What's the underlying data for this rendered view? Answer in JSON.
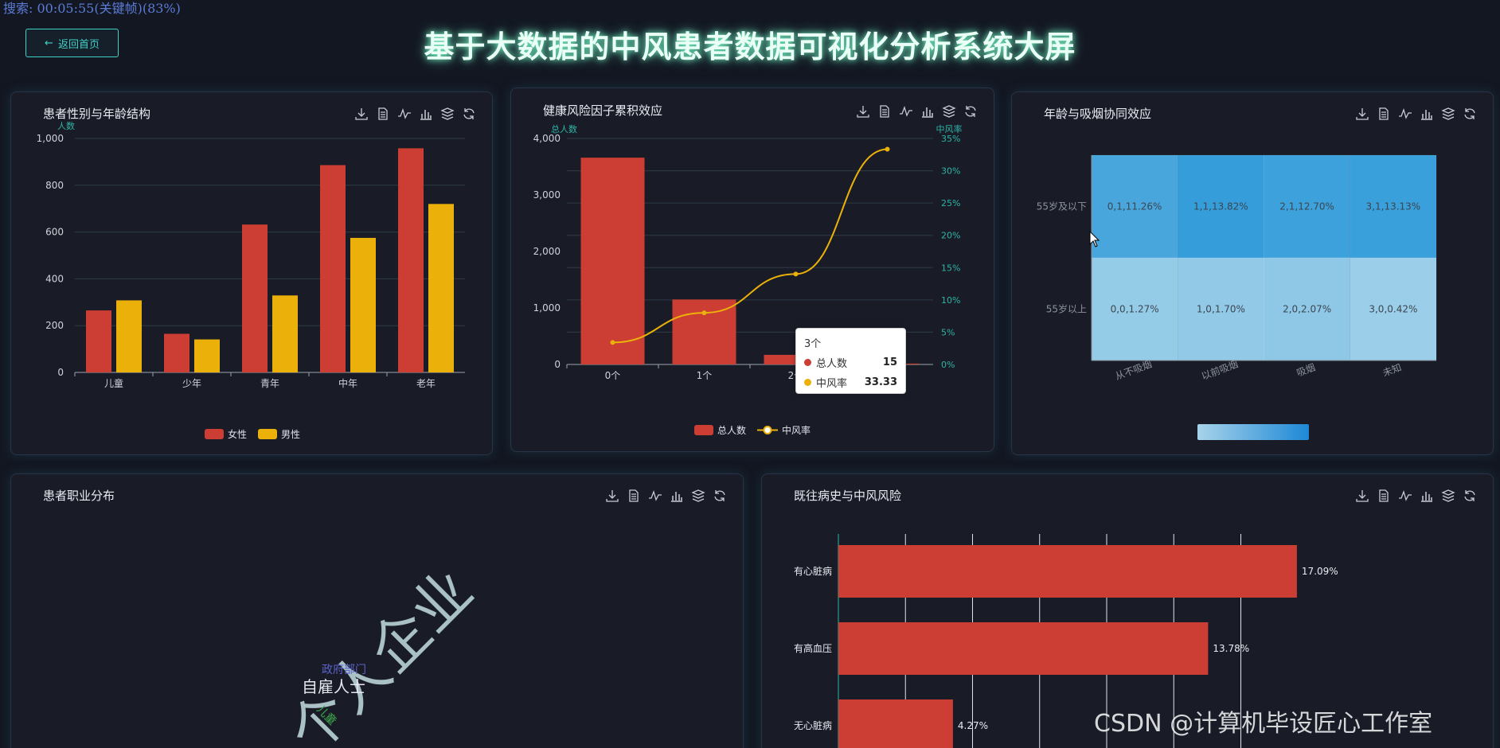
{
  "recording_status": "搜索: 00:05:55(关键帧)(83%)",
  "back_button": {
    "arrow": "←",
    "label": "返回首页"
  },
  "page_title": "基于大数据的中风患者数据可视化分析系统大屏",
  "watermark": "CSDN @计算机毕设匠心工作室",
  "toolbox_icons": [
    "download-icon",
    "data-view-icon",
    "line-switch-icon",
    "bar-switch-icon",
    "stack-icon",
    "restore-icon"
  ],
  "colors": {
    "red": "#cc3d33",
    "yellow": "#ebb10a",
    "teal": "#3fd1c6",
    "heat_dark": "#3a9bdc",
    "heat_light": "#8ec8e6"
  },
  "panels": {
    "gender_age": {
      "title": "患者性别与年龄结构"
    },
    "risk": {
      "title": "健康风险因子累积效应"
    },
    "smoke": {
      "title": "年龄与吸烟协同效应"
    },
    "job": {
      "title": "患者职业分布"
    },
    "history": {
      "title": "既往病史与中风风险"
    }
  },
  "chart_data": [
    {
      "id": "gender_age",
      "type": "bar",
      "ylabel": "人数",
      "ylim": [
        0,
        1000
      ],
      "yticks": [
        "0",
        "200",
        "400",
        "600",
        "800",
        "1,000"
      ],
      "categories": [
        "儿童",
        "少年",
        "青年",
        "中年",
        "老年"
      ],
      "series": [
        {
          "name": "女性",
          "color": "#cc3d33",
          "values": [
            265,
            165,
            632,
            886,
            958
          ]
        },
        {
          "name": "男性",
          "color": "#ebb10a",
          "values": [
            308,
            141,
            329,
            575,
            720
          ]
        }
      ]
    },
    {
      "id": "risk",
      "type": "bar",
      "ylabel": "总人数",
      "ylabel_right": "中风率",
      "ylim": [
        0,
        4000
      ],
      "ylim_right": [
        0,
        35
      ],
      "yticks": [
        "0",
        "1,000",
        "2,000",
        "3,000",
        "4,000"
      ],
      "yticks_right": [
        "0%",
        "5%",
        "10%",
        "15%",
        "20%",
        "25%",
        "30%",
        "35%"
      ],
      "categories": [
        "0个",
        "1个",
        "2个",
        "3个"
      ],
      "series": [
        {
          "name": "总人数",
          "kind": "bar",
          "color": "#cc3d33",
          "values": [
            3660,
            1150,
            170,
            15
          ]
        },
        {
          "name": "中风率",
          "kind": "line",
          "color": "#ebb10a",
          "values": [
            3.4,
            8,
            14,
            33.33
          ]
        }
      ],
      "tooltip": {
        "title": "3个",
        "rows": [
          {
            "name": "总人数",
            "value": "15"
          },
          {
            "name": "中风率",
            "value": "33.33"
          }
        ]
      }
    },
    {
      "id": "smoke",
      "type": "heatmap",
      "x_categories": [
        "从不吸烟",
        "以前吸烟",
        "吸烟",
        "未知"
      ],
      "y_categories": [
        "55岁以上",
        "55岁及以下"
      ],
      "cells": [
        {
          "x": 0,
          "y": 1,
          "value": 11.26,
          "label": "0,1,11.26%"
        },
        {
          "x": 1,
          "y": 1,
          "value": 13.82,
          "label": "1,1,13.82%"
        },
        {
          "x": 2,
          "y": 1,
          "value": 12.7,
          "label": "2,1,12.70%"
        },
        {
          "x": 3,
          "y": 1,
          "value": 13.13,
          "label": "3,1,13.13%"
        },
        {
          "x": 0,
          "y": 0,
          "value": 1.27,
          "label": "0,0,1.27%"
        },
        {
          "x": 1,
          "y": 0,
          "value": 1.7,
          "label": "1,0,1.70%"
        },
        {
          "x": 2,
          "y": 0,
          "value": 2.07,
          "label": "2,0,2.07%"
        },
        {
          "x": 3,
          "y": 0,
          "value": 0.42,
          "label": "3,0,0.42%"
        }
      ]
    },
    {
      "id": "history",
      "type": "bar",
      "orientation": "horizontal",
      "xlim": [
        0,
        20
      ],
      "categories": [
        "有心脏病",
        "有高血压",
        "无心脏病"
      ],
      "values": [
        17.09,
        13.78,
        4.27
      ],
      "labels": [
        "17.09%",
        "13.78%",
        "4.27%"
      ],
      "color": "#cc3d33"
    }
  ],
  "wordcloud": [
    {
      "text": "个人企业",
      "color": "#a9c0c5"
    },
    {
      "text": "政府部门",
      "color": "#5b62c9"
    },
    {
      "text": "自雇人士",
      "color": "#e4e8ee"
    },
    {
      "text": "儿童",
      "color": "#3fae4e"
    }
  ]
}
